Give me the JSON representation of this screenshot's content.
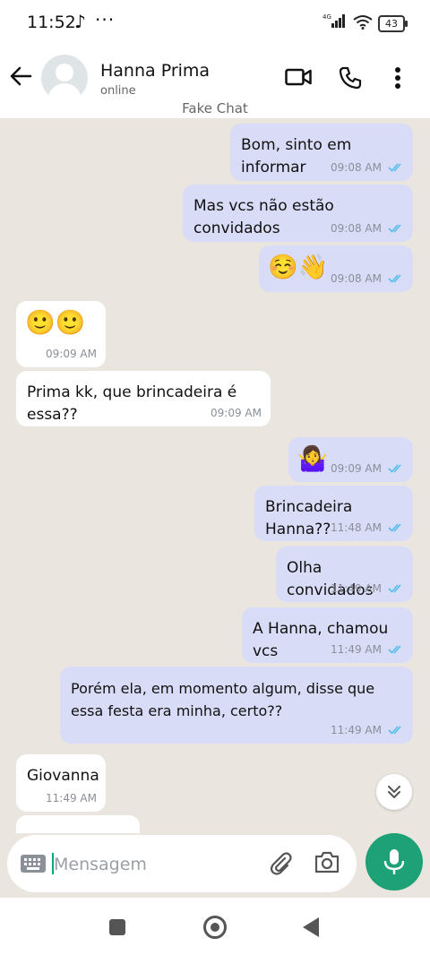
{
  "status_bar": {
    "time": "11:52",
    "network": "4G",
    "battery": "43"
  },
  "header": {
    "name": "Hanna Prima",
    "status": "online",
    "label": "Fake Chat"
  },
  "messages": [
    {
      "text": "Bom, sinto em informar",
      "time": "09:08 AM"
    },
    {
      "text": "Mas vcs não estão convidados",
      "time": "09:08 AM"
    },
    {
      "emoji": "☺️👋",
      "time": "09:08 AM"
    },
    {
      "emoji": "🙂🙂",
      "time": "09:09 AM"
    },
    {
      "text": "Prima kk, que brincadeira é essa??",
      "time": "09:09 AM"
    },
    {
      "emoji": "🤷‍♀️",
      "time": "09:09 AM"
    },
    {
      "text": "Brincadeira Hanna??",
      "time": "11:48 AM"
    },
    {
      "text": "Olha convidados",
      "time": "11:49 AM"
    },
    {
      "text": "A Hanna, chamou vcs",
      "time": "11:49 AM"
    },
    {
      "text": "Porém ela, em momento algum, disse que essa festa era minha, certo??",
      "time": "11:49 AM"
    },
    {
      "text": "Giovanna",
      "time": "11:49 AM"
    }
  ],
  "composer": {
    "placeholder": "Mensagem"
  },
  "colors": {
    "outgoing": "#d9dcf7",
    "incoming": "#ffffff",
    "chat_bg": "#eae6df",
    "accent": "#1ea176",
    "ticks": "#53bdeb"
  },
  "icons": [
    "back-arrow-icon",
    "video-call-icon",
    "phone-icon",
    "more-vert-icon",
    "double-check-icon",
    "chevron-double-down-icon",
    "keyboard-icon",
    "attach-icon",
    "camera-icon",
    "mic-icon"
  ]
}
